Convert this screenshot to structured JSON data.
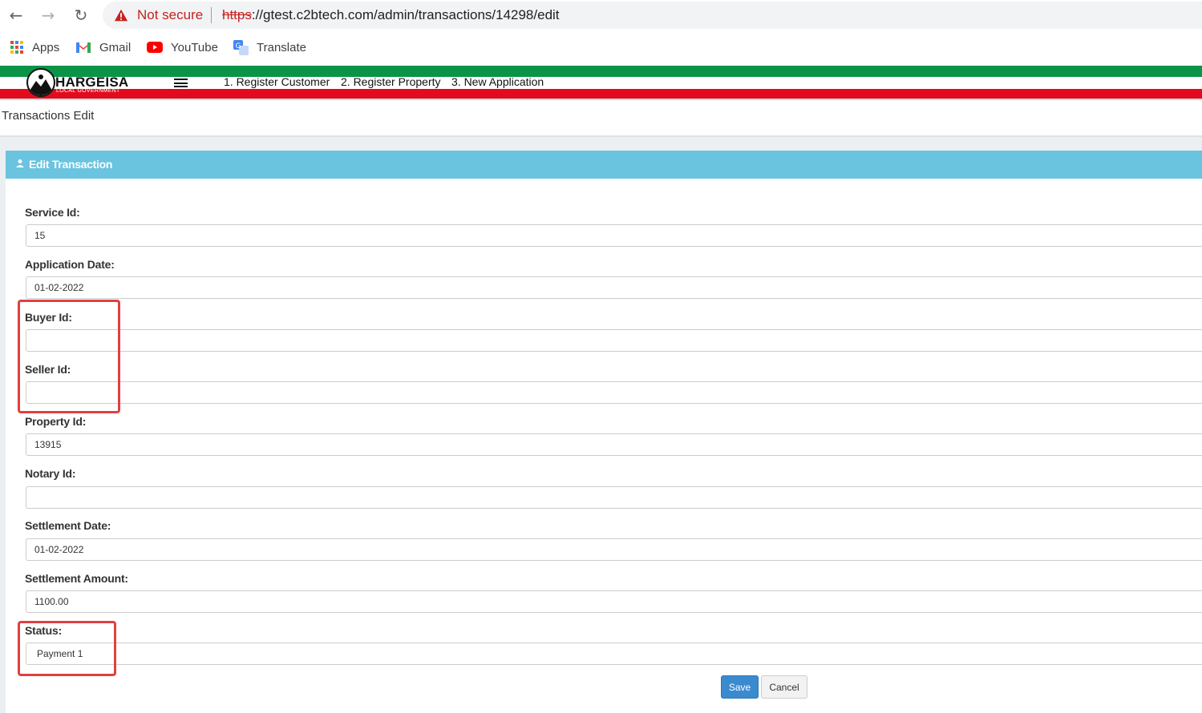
{
  "browser": {
    "not_secure": "Not secure",
    "url_scheme": "https",
    "url_rest": "://gtest.c2btech.com/admin/transactions/14298/edit",
    "bookmarks": [
      {
        "label": "Apps",
        "icon": "apps-grid-icon"
      },
      {
        "label": "Gmail",
        "icon": "gmail-icon"
      },
      {
        "label": "YouTube",
        "icon": "youtube-icon"
      },
      {
        "label": "Translate",
        "icon": "translate-icon"
      }
    ]
  },
  "header": {
    "logo_text": "HARGEISA",
    "logo_sub": "LOCAL GOVERNMENT",
    "menu": [
      "1. Register Customer",
      "2. Register Property",
      "3. New Application"
    ]
  },
  "page": {
    "title": "Transactions Edit"
  },
  "panel": {
    "title": "Edit Transaction"
  },
  "form": {
    "fields": [
      {
        "label": "Service Id:",
        "value": "15"
      },
      {
        "label": "Application Date:",
        "value": "01-02-2022"
      },
      {
        "label": "Buyer Id:",
        "value": ""
      },
      {
        "label": "Seller Id:",
        "value": ""
      },
      {
        "label": "Property Id:",
        "value": "13915"
      },
      {
        "label": "Notary Id:",
        "value": ""
      },
      {
        "label": "Settlement Date:",
        "value": "01-02-2022"
      },
      {
        "label": "Settlement Amount:",
        "value": "1100.00"
      },
      {
        "label": "Status:",
        "value": "Payment 1"
      }
    ],
    "save_label": "Save",
    "cancel_label": "Cancel"
  },
  "colors": {
    "panel_header": "#6ac4df",
    "save_button": "#3b8ad0",
    "stripe_green": "#0b9347",
    "stripe_red": "#e10b1d",
    "highlight": "#e04040"
  }
}
